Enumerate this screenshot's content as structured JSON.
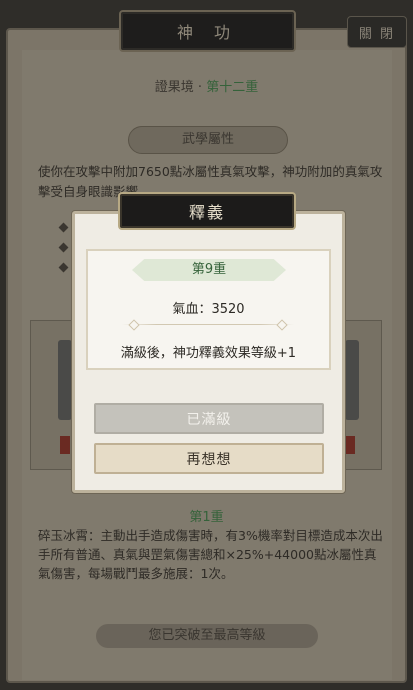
{
  "header": {
    "title": "神 功",
    "close_label": "關 閉"
  },
  "realm": {
    "prefix": "證果境 · ",
    "level": "第十二重"
  },
  "attributes": {
    "heading": "武學屬性",
    "description": "使你在攻擊中附加7650點冰屬性真氣攻擊，神功附加的真氣攻擊受自身眼識影響"
  },
  "skill": {
    "level_label": "第1重",
    "description": "碎玉冰霄：主動出手造成傷害時，有3%機率對目標造成本次出手所有普通、真氣與罡氣傷害總和×25%+44000點冰屬性真氣傷害，每場戰鬥最多施展：1次。"
  },
  "footer": {
    "status": "您已突破至最高等級"
  },
  "modal": {
    "title": "釋義",
    "level": "第9重",
    "hp": "氣血：3520",
    "effect": "滿級後，神功釋義效果等級+1",
    "btn_maxed": "已滿級",
    "btn_reconsider": "再想想"
  }
}
